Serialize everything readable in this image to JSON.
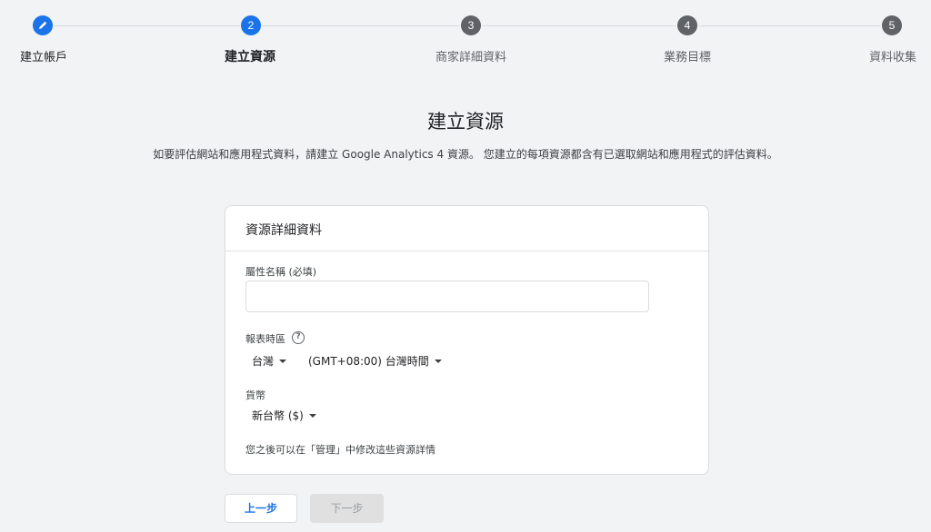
{
  "stepper": {
    "steps": [
      {
        "number": "",
        "label": "建立帳戶",
        "icon": "pencil-icon"
      },
      {
        "number": "2",
        "label": "建立資源"
      },
      {
        "number": "3",
        "label": "商家詳細資料"
      },
      {
        "number": "4",
        "label": "業務目標"
      },
      {
        "number": "5",
        "label": "資料收集"
      }
    ],
    "current_step": 2
  },
  "main": {
    "title": "建立資源",
    "description": "如要評估網站和應用程式資料，請建立 Google Analytics 4 資源。 您建立的每項資源都含有已選取網站和應用程式的評估資料。"
  },
  "card": {
    "header": "資源詳細資料",
    "property_name_label": "屬性名稱 (必填)",
    "property_name_value": "",
    "timezone_label": "報表時區",
    "help_icon_glyph": "?",
    "country_value": "台灣",
    "timezone_value": "(GMT+08:00) 台灣時間",
    "currency_label": "貨幣",
    "currency_value": "新台幣 ($)",
    "hint": "您之後可以在「管理」中修改這些資源詳情"
  },
  "buttons": {
    "back": "上一步",
    "next": "下一步"
  },
  "colors": {
    "accent": "#1a73e8",
    "inactive_step": "#5f6368",
    "background": "#f1f3f4"
  }
}
